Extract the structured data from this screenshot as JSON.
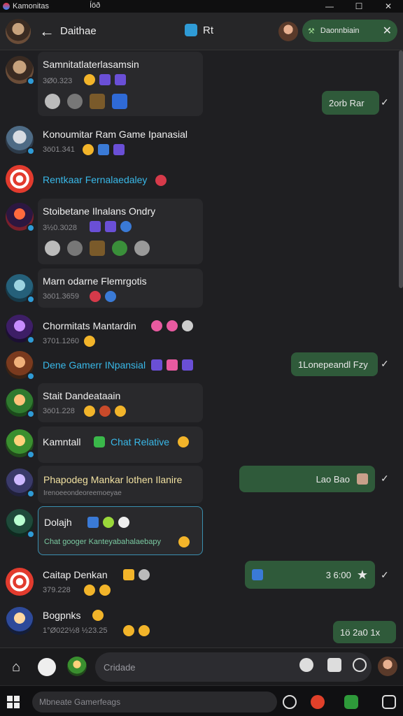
{
  "window": {
    "title": "Kamonitas",
    "tab_text": "Íöð",
    "buttons": [
      "—",
      "☐",
      "✕"
    ]
  },
  "header": {
    "back_icon": "arrow-left-icon",
    "title": "Daithae",
    "mid_label": "Rt",
    "pill_label": "Daonnbiain",
    "pill_close": "✕"
  },
  "conversations": [
    {
      "name": "Samnitatlaterlasamsin",
      "sub": "3Ø0.323"
    },
    {
      "name": "Konoumitar Ram Game Ipanasial",
      "sub": "3ö01.341"
    },
    {
      "name": "Rentkaar Fernalaedaley",
      "sub": ""
    },
    {
      "name": "Stoibetane Ilnalans Ondry",
      "sub": "3½0.3028"
    },
    {
      "name": "Marn odarne Flemrgotis",
      "sub": "3ö01.3659"
    },
    {
      "name": "Chormitats Mantardin",
      "sub": "3701.1260"
    },
    {
      "name": "Dene Gamerr INpansial",
      "sub": ""
    },
    {
      "name": "Stait Dandeataain",
      "sub": "3ö01.228"
    },
    {
      "name": "Kamntall",
      "sub": "",
      "extra": "Chat Relative"
    },
    {
      "name": "Phapodeg Mankar lothen Ilanire",
      "sub": "Irenoeeondeoreemoeyae"
    },
    {
      "name": "Dolajh",
      "sub": "",
      "extra": "Chat googer Kanteyabahalaebapy"
    },
    {
      "name": "Caitap Denkan",
      "sub": "379.228"
    },
    {
      "name": "Bogpnks",
      "sub": "1°Ø022½8 ½23.25"
    }
  ],
  "outgoing": [
    {
      "text": "2orb Rar"
    },
    {
      "text": "1Lonepeandl Fzy"
    },
    {
      "text": "Lao Bao"
    },
    {
      "text": "3 6:00"
    },
    {
      "text": "1ö 2a0 1x"
    }
  ],
  "composer": {
    "placeholder": "Cridade"
  },
  "taskbar": {
    "search": "Mbneate Gamerfeags"
  }
}
